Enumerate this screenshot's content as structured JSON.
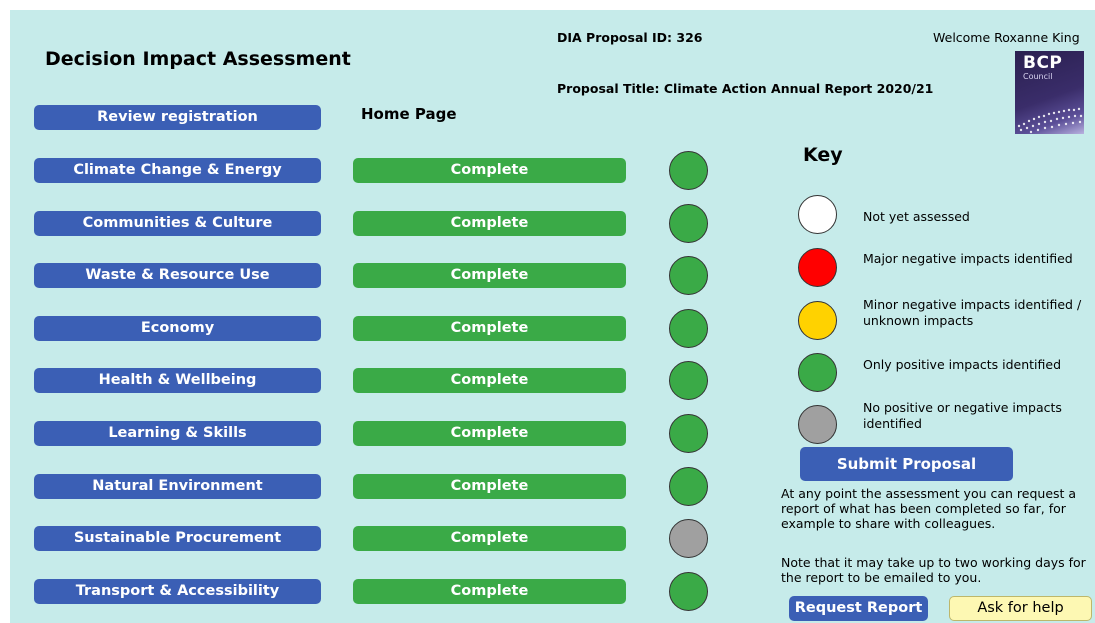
{
  "header": {
    "title": "Decision Impact Assessment",
    "proposal_id": "DIA Proposal ID: 326",
    "proposal_title": "Proposal Title: Climate Action Annual Report 2020/21",
    "welcome": "Welcome Roxanne King",
    "page_label": "Home Page"
  },
  "logo": {
    "name": "BCP",
    "sub": "Council"
  },
  "review_button": "Review registration",
  "sections": [
    {
      "label": "Climate Change & Energy",
      "status": "Complete",
      "indicator": "#3aaa47"
    },
    {
      "label": "Communities & Culture",
      "status": "Complete",
      "indicator": "#3aaa47"
    },
    {
      "label": "Waste & Resource Use",
      "status": "Complete",
      "indicator": "#3aaa47"
    },
    {
      "label": "Economy",
      "status": "Complete",
      "indicator": "#3aaa47"
    },
    {
      "label": "Health & Wellbeing",
      "status": "Complete",
      "indicator": "#3aaa47"
    },
    {
      "label": "Learning & Skills",
      "status": "Complete",
      "indicator": "#3aaa47"
    },
    {
      "label": "Natural Environment",
      "status": "Complete",
      "indicator": "#3aaa47"
    },
    {
      "label": "Sustainable Procurement",
      "status": "Complete",
      "indicator": "#a0a0a0"
    },
    {
      "label": "Transport & Accessibility",
      "status": "Complete",
      "indicator": "#3aaa47"
    }
  ],
  "key": {
    "title": "Key",
    "items": [
      {
        "label": "Not yet assessed",
        "color": "#ffffff"
      },
      {
        "label": "Major negative impacts identified",
        "color": "#ff0000"
      },
      {
        "label": "Minor negative impacts identified / unknown impacts",
        "color": "#ffd200"
      },
      {
        "label": "Only positive impacts identified",
        "color": "#3aaa47"
      },
      {
        "label": "No positive or negative impacts identified",
        "color": "#a0a0a0"
      }
    ]
  },
  "actions": {
    "submit": "Submit Proposal",
    "note1": "At any point the assessment you can request a report of what has been completed so far, for example to share with colleagues.",
    "note2": "Note that it may take up to two working days for the report to be emailed to you.",
    "request": "Request Report",
    "help": "Ask for help"
  }
}
